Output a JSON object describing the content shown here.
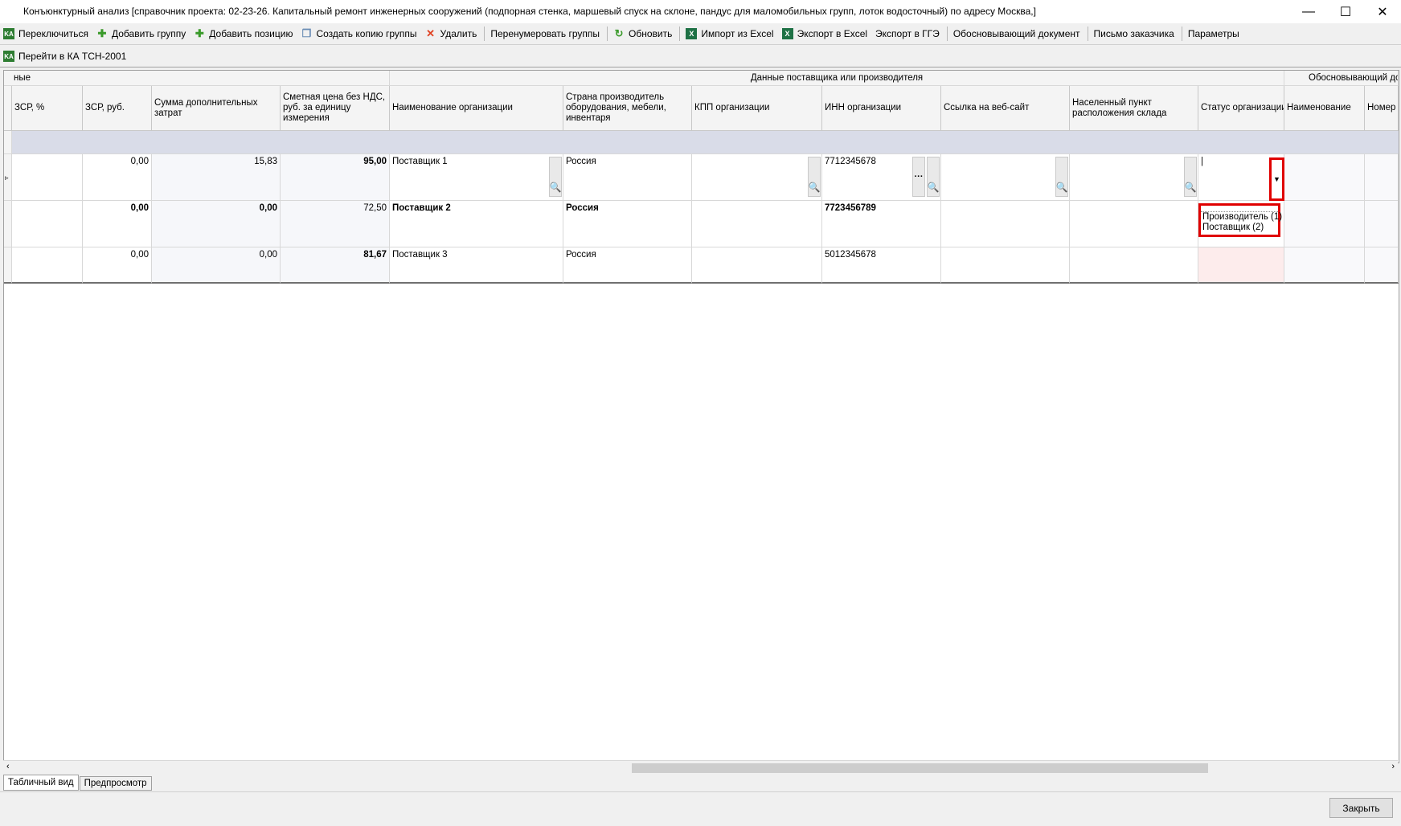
{
  "window": {
    "title": "Конъюнктурный анализ [справочник проекта: 02-23-26. Капитальный ремонт инженерных сооружений (подпорная стенка, маршевый спуск на склоне, пандус для маломобильных групп, лоток водосточный) по адресу Москва,]",
    "minimize": "—",
    "maximize": "☐",
    "close": "✕"
  },
  "toolbar": {
    "switch": "Переключиться",
    "add_group": "Добавить группу",
    "add_position": "Добавить позицию",
    "copy_group": "Создать копию группы",
    "delete": "Удалить",
    "renumber": "Перенумеровать группы",
    "refresh": "Обновить",
    "import_excel": "Импорт из Excel",
    "export_excel": "Экспорт в Excel",
    "export_gge": "Экспорт в ГГЭ",
    "justification_doc": "Обосновывающий документ",
    "customer_letter": "Письмо заказчика",
    "params": "Параметры"
  },
  "toolbar2": {
    "goto_ka": "Перейти в КА ТСН-2001"
  },
  "grid": {
    "bands": {
      "left": "ные",
      "supplier": "Данные поставщика или производителя",
      "justification": "Обосновывающий док"
    },
    "columns": {
      "zsr_pct": "ЗСР, %",
      "zsr_rub": "ЗСР, руб.",
      "extra": "Сумма дополнительных затрат",
      "price": "Сметная цена без НДС, руб. за единицу измерения",
      "org_name": "Наименование организации",
      "country": "Страна производитель оборудования, мебели, инвентаря",
      "kpp": "КПП организации",
      "inn": "ИНН организации",
      "website": "Ссылка на веб-сайт",
      "city": "Населенный пункт расположения склада",
      "status": "Статус организации",
      "doc_name": "Наименование",
      "doc_num": "Номер д"
    },
    "rows": [
      {
        "zsr_rub": "0,00",
        "extra": "15,83",
        "price": "95,00",
        "org": "Поставщик 1",
        "country": "Россия",
        "inn": "7712345678",
        "status": "|"
      },
      {
        "zsr_rub": "0,00",
        "extra": "0,00",
        "price": "72,50",
        "org": "Поставщик 2",
        "country": "Россия",
        "inn": "7723456789"
      },
      {
        "zsr_rub": "0,00",
        "extra": "0,00",
        "price": "81,67",
        "org": "Поставщик 3",
        "country": "Россия",
        "inn": "5012345678"
      }
    ]
  },
  "dropdown": {
    "options": [
      "Производитель (1)",
      "Поставщик (2)"
    ]
  },
  "tabs": {
    "table": "Табличный вид",
    "preview": "Предпросмотр"
  },
  "buttons": {
    "close": "Закрыть"
  },
  "colors": {
    "highlight": "#e00000",
    "group_row": "#d9dce8"
  }
}
